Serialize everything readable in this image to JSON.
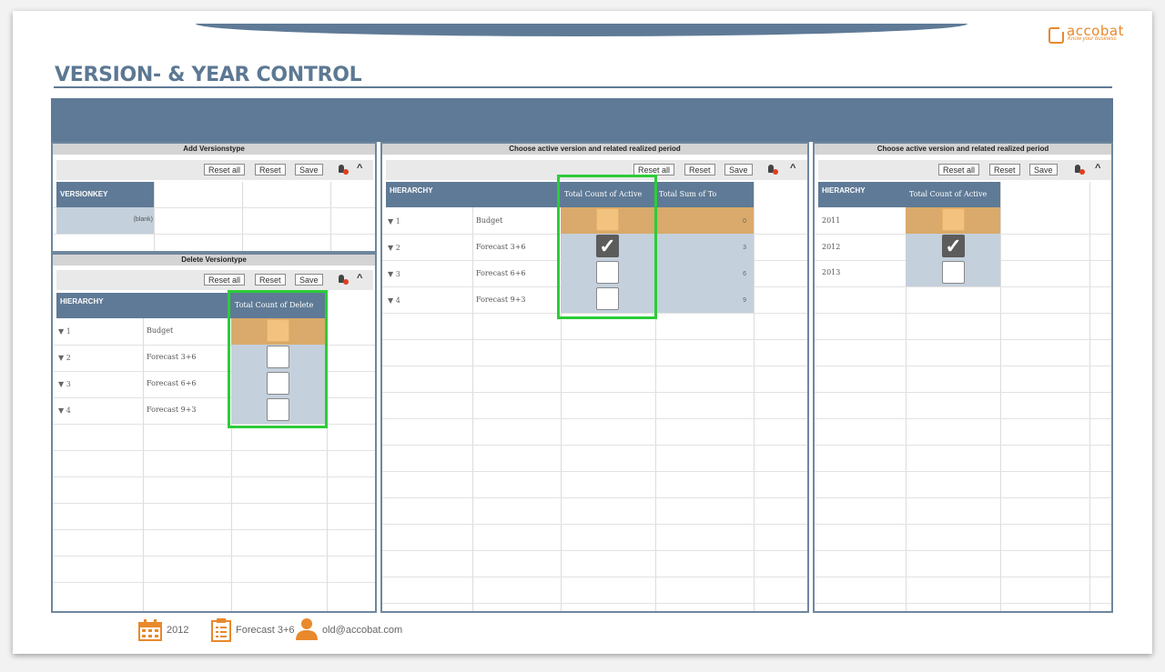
{
  "app": {
    "page_title": "VERSION- & YEAR CONTROL",
    "logo_text": "accobat",
    "logo_sub": "Know your business"
  },
  "toolbar": {
    "reset_all": "Reset all",
    "reset": "Reset",
    "save": "Save"
  },
  "add_panel": {
    "title": "Add Versionstype",
    "header": "VERSIONKEY",
    "row_value": "(blank)"
  },
  "delete_panel": {
    "title": "Delete Versiontype",
    "headers": {
      "hierarchy": "HIERARCHY",
      "count": "Total Count of Delete"
    },
    "rows": [
      {
        "id": "1",
        "name": "Budget",
        "state": "selected"
      },
      {
        "id": "2",
        "name": "Forecast 3+6",
        "state": "unchecked"
      },
      {
        "id": "3",
        "name": "Forecast 6+6",
        "state": "unchecked"
      },
      {
        "id": "4",
        "name": "Forecast 9+3",
        "state": "unchecked"
      }
    ]
  },
  "active_panel": {
    "title": "Choose active version and related realized period",
    "headers": {
      "hierarchy": "HIERARCHY",
      "count": "Total Count of Active",
      "sum": "Total Sum of To"
    },
    "rows": [
      {
        "id": "1",
        "name": "Budget",
        "state": "selected",
        "sum": "0"
      },
      {
        "id": "2",
        "name": "Forecast 3+6",
        "state": "checked",
        "sum": "3"
      },
      {
        "id": "3",
        "name": "Forecast 6+6",
        "state": "unchecked",
        "sum": "6"
      },
      {
        "id": "4",
        "name": "Forecast 9+3",
        "state": "unchecked",
        "sum": "9"
      }
    ]
  },
  "year_panel": {
    "title": "Choose active version and related realized period",
    "headers": {
      "hierarchy": "HIERARCHY",
      "count": "Total Count of Active"
    },
    "rows": [
      {
        "year": "2011",
        "state": "selected"
      },
      {
        "year": "2012",
        "state": "checked"
      },
      {
        "year": "2013",
        "state": "unchecked"
      }
    ]
  },
  "footer": {
    "year": "2012",
    "version": "Forecast 3+6",
    "user": "old@accobat.com"
  },
  "colors": {
    "header_blue": "#5f7a96",
    "accent_orange": "#e8892c",
    "highlight_green": "#2ccc38",
    "selected_gold": "#d9aa6b"
  }
}
